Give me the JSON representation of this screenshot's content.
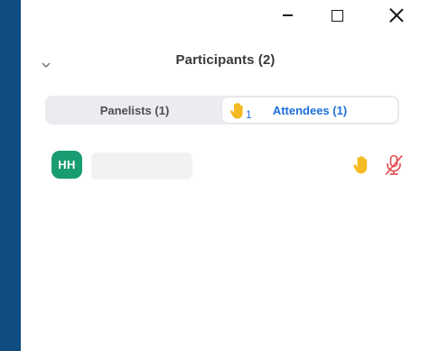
{
  "window_controls": {
    "minimize_icon": "minimize-icon",
    "maximize_icon": "maximize-icon",
    "close_icon": "close-icon"
  },
  "header": {
    "title": "Participants (2)",
    "collapse_icon": "chevron-down-icon"
  },
  "tabs": [
    {
      "label": "Panelists (1)",
      "active": false
    },
    {
      "label": "Attendees (1)",
      "active": true,
      "raised_hands": "1"
    }
  ],
  "participants": [
    {
      "initials": "HH",
      "name": "",
      "hand_raised": true,
      "mic_muted": true
    }
  ],
  "colors": {
    "accent": "#1f6fd9",
    "avatar": "#1a9c73",
    "hand": "#f5b921",
    "muted": "#e5484d",
    "desktop": "#0f4c81"
  }
}
